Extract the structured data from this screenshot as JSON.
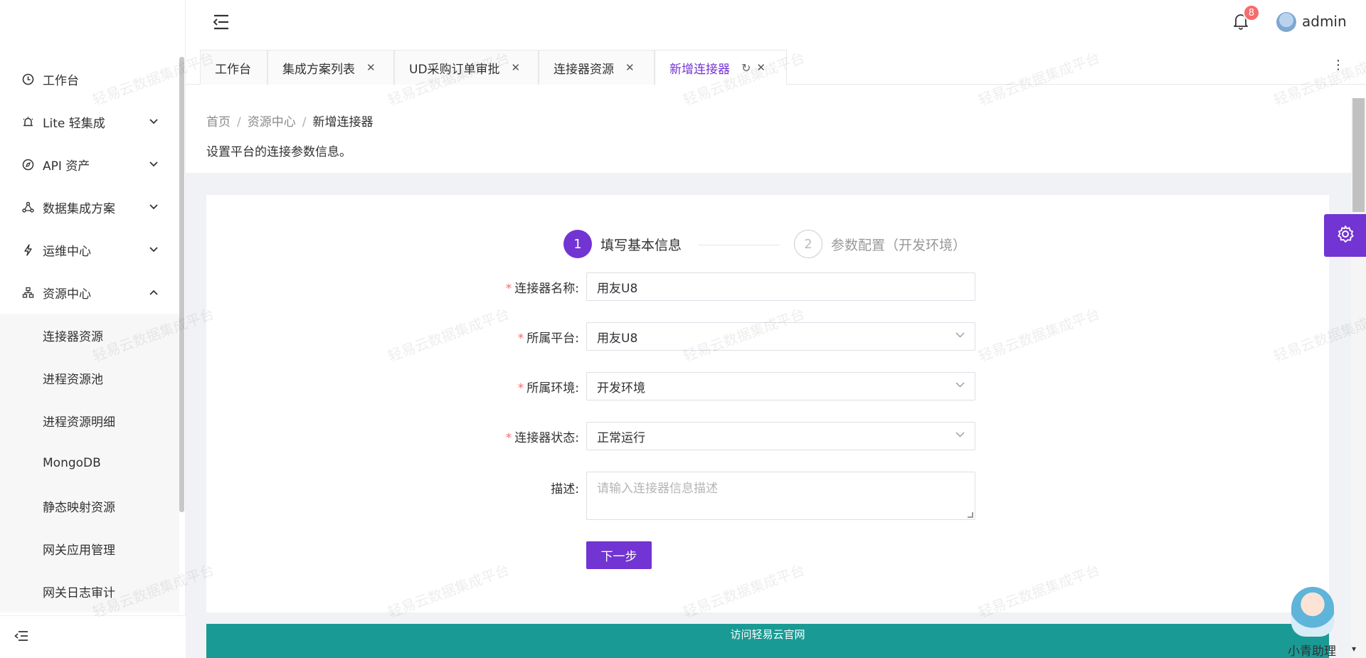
{
  "sidebar": {
    "items": [
      {
        "label": "工作台",
        "icon": "clock-icon"
      },
      {
        "label": "Lite 轻集成",
        "icon": "alarm-icon"
      },
      {
        "label": "API 资产",
        "icon": "compass-icon"
      },
      {
        "label": "数据集成方案",
        "icon": "share-icon"
      },
      {
        "label": "运维中心",
        "icon": "bolt-icon"
      },
      {
        "label": "资源中心",
        "icon": "sitemap-icon"
      }
    ],
    "subitems": [
      "连接器资源",
      "进程资源池",
      "进程资源明细",
      "MongoDB",
      "静态映射资源",
      "网关应用管理",
      "网关日志审计"
    ]
  },
  "header": {
    "notification_count": "8",
    "username": "admin"
  },
  "tabs": [
    {
      "label": "工作台"
    },
    {
      "label": "集成方案列表"
    },
    {
      "label": "UD采购订单审批"
    },
    {
      "label": "连接器资源"
    },
    {
      "label": "新增连接器"
    }
  ],
  "breadcrumb": {
    "home": "首页",
    "section": "资源中心",
    "current": "新增连接器"
  },
  "page": {
    "description": "设置平台的连接参数信息。"
  },
  "steps": [
    {
      "number": "1",
      "label": "填写基本信息"
    },
    {
      "number": "2",
      "label": "参数配置（开发环境）"
    }
  ],
  "form": {
    "name_label": "连接器名称:",
    "name_value": "用友U8",
    "platform_label": "所属平台:",
    "platform_value": "用友U8",
    "env_label": "所属环境:",
    "env_value": "开发环境",
    "status_label": "连接器状态:",
    "status_value": "正常运行",
    "desc_label": "描述:",
    "desc_placeholder": "请输入连接器信息描述",
    "next_button": "下一步"
  },
  "banner": {
    "title": "访问轻易云官网"
  },
  "assistant": {
    "label": "小青助理"
  },
  "watermark": "轻易云数据集成平台",
  "colors": {
    "accent": "#7234d3",
    "banner": "#1a9a94",
    "badge": "#f56c6c"
  }
}
